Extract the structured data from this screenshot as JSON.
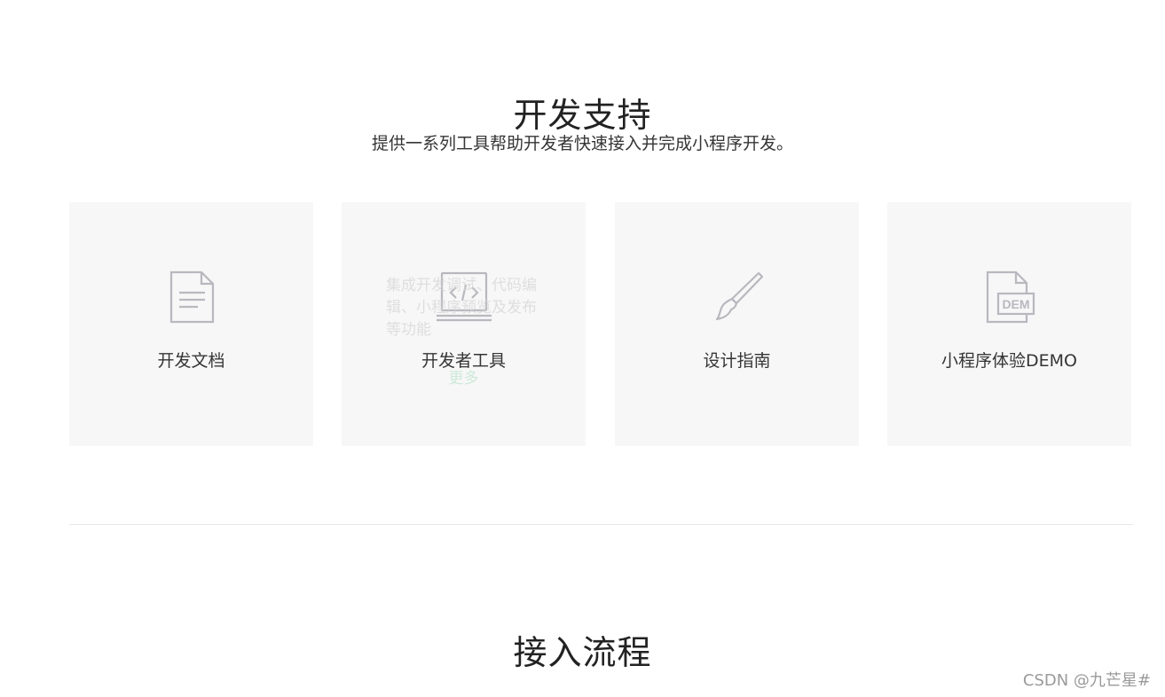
{
  "dev_support": {
    "title": "开发支持",
    "subtitle": "提供一系列工具帮助开发者快速接入并完成小程序开发。",
    "cards": [
      {
        "label": "开发文档",
        "icon": "document-icon"
      },
      {
        "label": "开发者工具",
        "icon": "laptop-code-icon",
        "desc": "集成开发调试、代码编辑、小程序预览及发布等功能",
        "more": "更多"
      },
      {
        "label": "设计指南",
        "icon": "paintbrush-icon"
      },
      {
        "label": "小程序体验DEMO",
        "icon": "demo-file-icon",
        "icon_text": "DEM"
      }
    ]
  },
  "access_flow": {
    "title": "接入流程"
  },
  "watermark": "CSDN @九芒星#",
  "colors": {
    "card_bg": "#f7f7f7",
    "icon_stroke": "#b8b8bf",
    "title_text": "#222222",
    "body_text": "#353535",
    "divider": "#e7e7e7"
  }
}
